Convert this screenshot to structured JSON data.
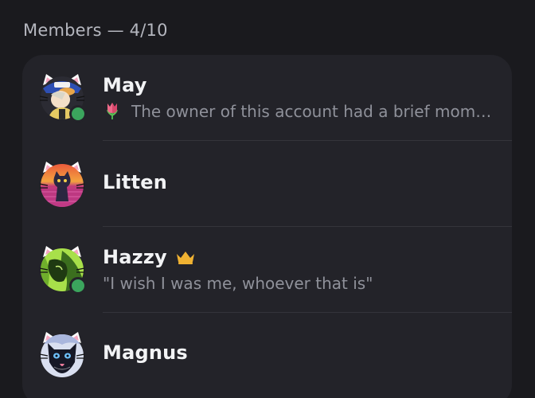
{
  "header": {
    "title": "Members — 4/10"
  },
  "members": [
    {
      "name": "May",
      "online": true,
      "status_emoji": "tulip-emoji",
      "status": "The owner of this account had a brief mome...",
      "crown": false
    },
    {
      "name": "Litten",
      "online": false,
      "status": "",
      "crown": false
    },
    {
      "name": "Hazzy",
      "online": true,
      "status": "\"I wish I was me, whoever that is\"",
      "crown": true,
      "crown_color": "#f0b232"
    },
    {
      "name": "Magnus",
      "online": false,
      "status": "",
      "crown": false
    }
  ],
  "colors": {
    "background": "#1a1a1e",
    "card": "#232329",
    "online": "#3ba55d",
    "name": "#f2f3f5",
    "status": "#8f919a"
  }
}
